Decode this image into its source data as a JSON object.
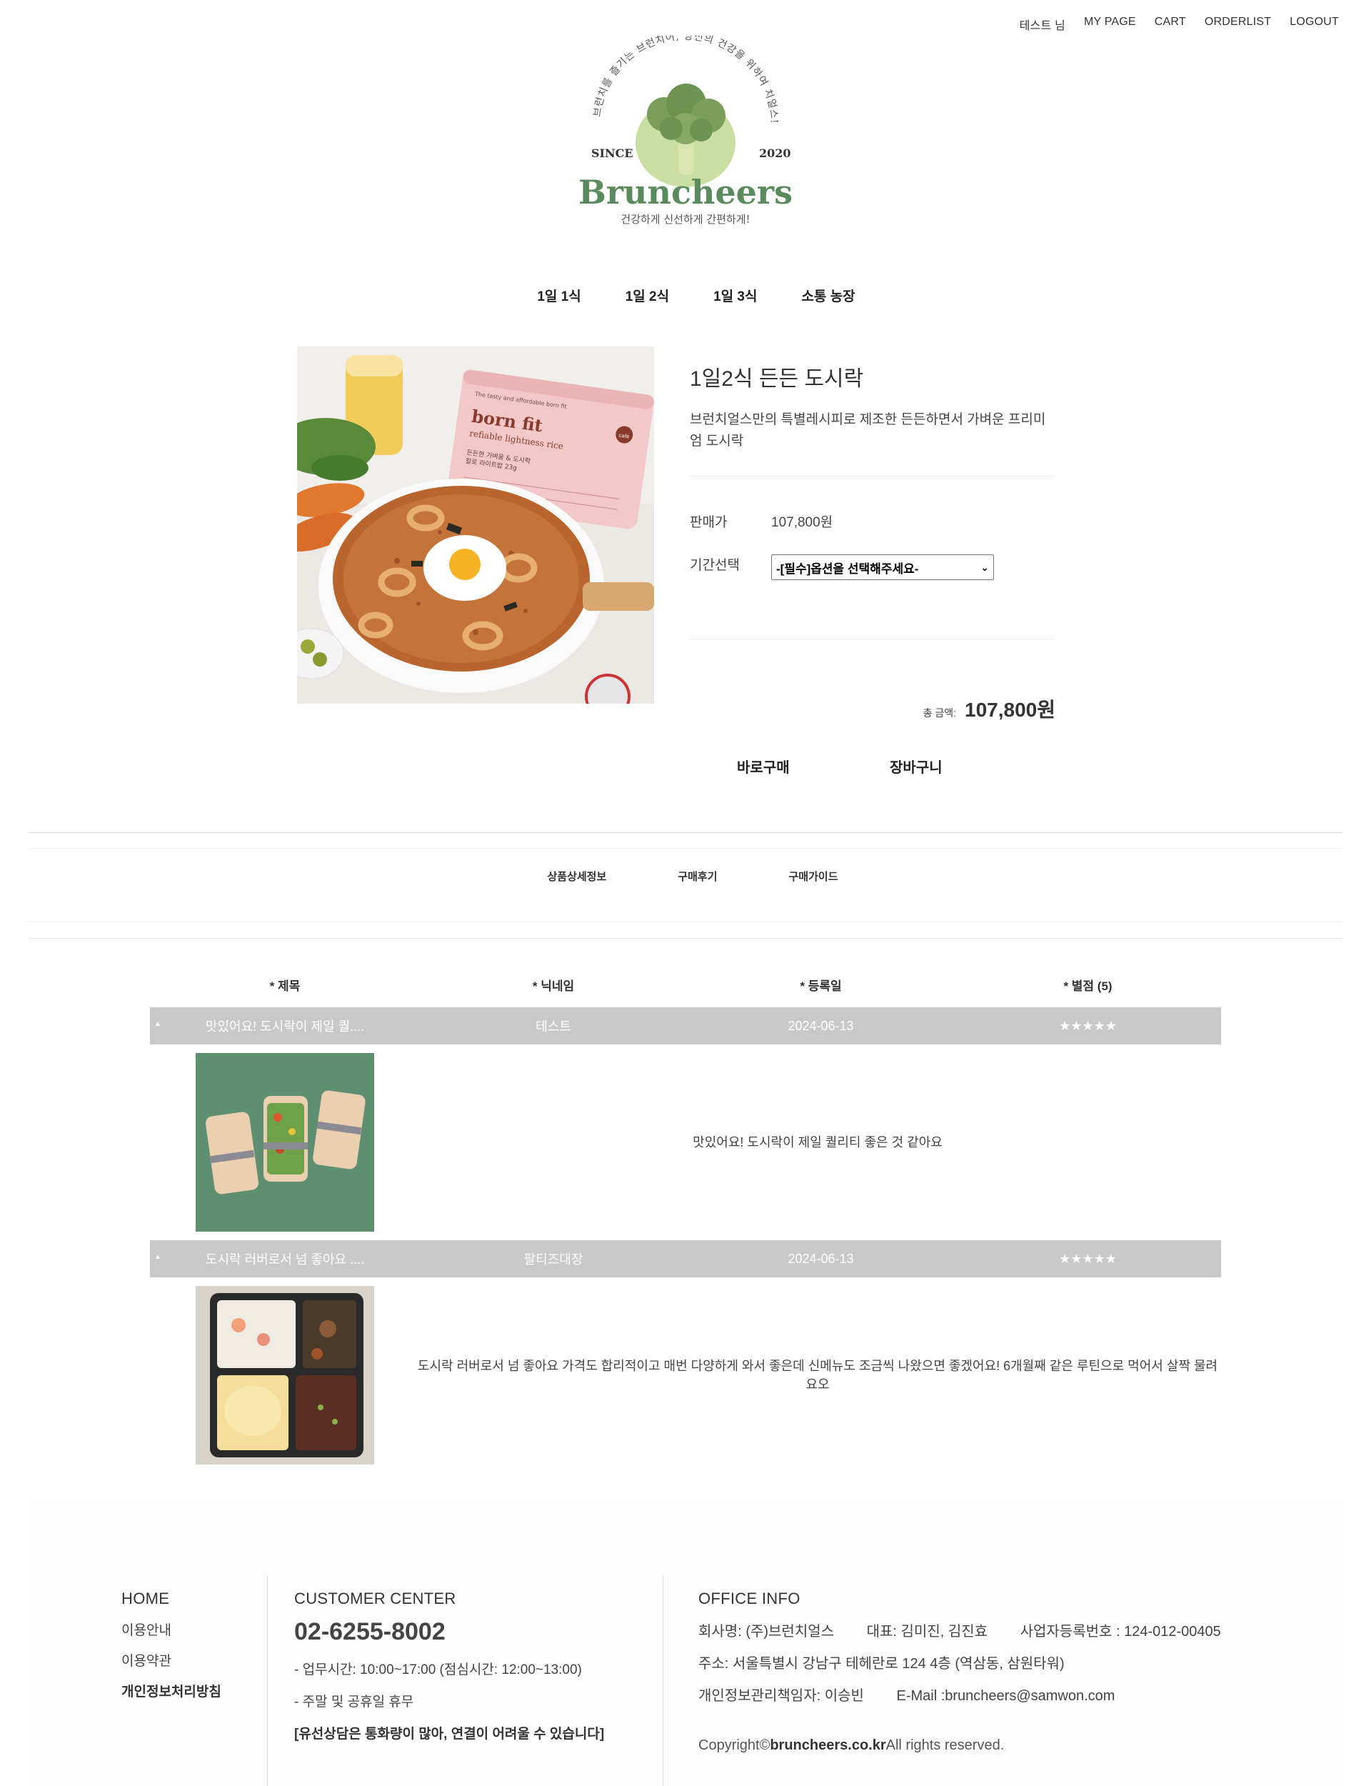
{
  "topnav": {
    "user": "테스트 님",
    "mypage": "MY PAGE",
    "cart": "CART",
    "orderlist": "ORDERLIST",
    "logout": "LOGOUT"
  },
  "logo": {
    "arc_text": "브런치를 즐기는 브런치어, 당신의 건강을 위하여 치얼스!",
    "since": "SINCE",
    "year": "2020",
    "brand": "Bruncheers",
    "tagline": "건강하게 신선하게 간편하게!"
  },
  "categories": [
    "1일 1식",
    "1일 2식",
    "1일 3식",
    "소통 농장"
  ],
  "product": {
    "name": "1일2식 든든 도시락",
    "description": "브런치얼스만의 특별레시피로 제조한 든든하면서 가벼운 프리미엄 도시락",
    "price_label": "판매가",
    "price": "107,800원",
    "period_label": "기간선택",
    "period_placeholder": "-[필수]옵션을 선택해주세요-",
    "total_label": "총 금액:",
    "total_value": "107,800원",
    "buy_label": "바로구매",
    "cart_label": "장바구니",
    "image_text": {
      "brand_small": "The tasty and affordable born fit",
      "brand": "born fit",
      "subtitle": "refiable lightness rice",
      "line1": "든든한 가벼움 & 도시락",
      "line2": "칼로 라이트밥 23g",
      "badge": "cafe"
    }
  },
  "tabs": [
    "상품상세정보",
    "구매후기",
    "구매가이드"
  ],
  "reviews": {
    "headers": [
      "* 제목",
      "* 닉네임",
      "* 등록일",
      "* 별점 (5)"
    ],
    "rows": [
      {
        "title": "맛있어요! 도시락이 제일 퀄....",
        "nickname": "테스트",
        "date": "2024-06-13",
        "stars": "★★★★★",
        "content": "맛있어요! 도시락이 제일 퀄리티 좋은 것 같아요"
      },
      {
        "title": "도시락 러버로서 넘 좋아요 ....",
        "nickname": "팔티즈대장",
        "date": "2024-06-13",
        "stars": "★★★★★",
        "content": "도시락 러버로서 넘 좋아요 가격도 합리적이고 매번 다양하게 와서 좋은데 신메뉴도 조금씩 나왔으면 좋겠어요! 6개월째 같은 루틴으로 먹어서 살짝 물려요오"
      }
    ]
  },
  "footer": {
    "home": {
      "title": "HOME",
      "links": [
        "이용안내",
        "이용약관",
        "개인정보처리방침"
      ]
    },
    "customer": {
      "title": "CUSTOMER CENTER",
      "tel": "02-6255-8002",
      "hours": "- 업무시간: 10:00~17:00 (점심시간: 12:00~13:00)",
      "holiday": "- 주말 및 공휴일 휴무",
      "notice": "[유선상담은 통화량이 많아, 연결이 어려울 수 있습니다]"
    },
    "office": {
      "title": "OFFICE INFO",
      "company": "회사명: (주)브런치얼스",
      "ceo": "대표: 김미진, 김진효",
      "bizno": "사업자등록번호 : 124-012-00405",
      "address": "주소: 서울특별시 강남구 테헤란로 124 4층 (역삼동, 삼원타워)",
      "privacy": "개인정보관리책임자: 이승빈",
      "email": "E-Mail :bruncheers@samwon.com",
      "copy_prefix": "Copyright©",
      "copy_domain": "bruncheers.co.kr",
      "copy_suffix": "All rights reserved."
    }
  },
  "colors": {
    "row_bg": "#c9c9c9",
    "brand_green": "#5a8a5e",
    "logo_blob": "#c9dea0"
  }
}
